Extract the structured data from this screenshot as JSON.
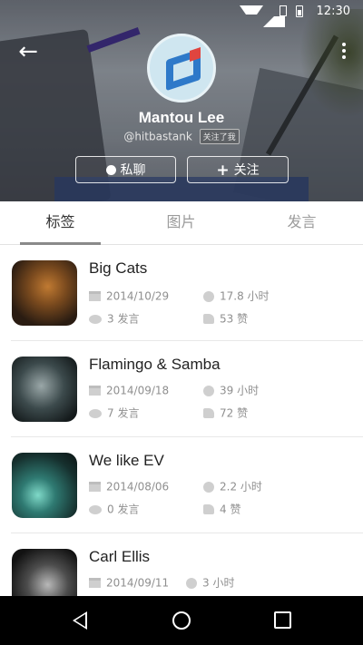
{
  "status_bar": {
    "time": "12:30"
  },
  "profile": {
    "name": "Mantou Lee",
    "handle": "@hitbastank",
    "follow_badge": "关注了我",
    "chat_button": "私聊",
    "follow_button": "关注"
  },
  "tabs": [
    {
      "label": "标签",
      "active": true
    },
    {
      "label": "图片",
      "active": false
    },
    {
      "label": "发言",
      "active": false
    }
  ],
  "items": [
    {
      "title": "Big Cats",
      "date": "2014/10/29",
      "duration": "17.8 小时",
      "posts": "3 发言",
      "likes": "53 赞"
    },
    {
      "title": "Flamingo & Samba",
      "date": "2014/09/18",
      "duration": "39 小时",
      "posts": "7 发言",
      "likes": "72 赞"
    },
    {
      "title": "We like EV",
      "date": "2014/08/06",
      "duration": "2.2 小时",
      "posts": "0 发言",
      "likes": "4 赞"
    },
    {
      "title": "Carl Ellis",
      "date": "2014/09/11",
      "duration": "3 小时",
      "posts": "",
      "likes": ""
    }
  ],
  "icons": {
    "back": "arrow-left-icon",
    "more": "more-vertical-icon",
    "chat": "chat-bubble-icon",
    "follow": "plus-icon",
    "date": "calendar-icon",
    "duration": "clock-icon",
    "posts": "comment-icon",
    "likes": "thumbs-up-icon"
  }
}
